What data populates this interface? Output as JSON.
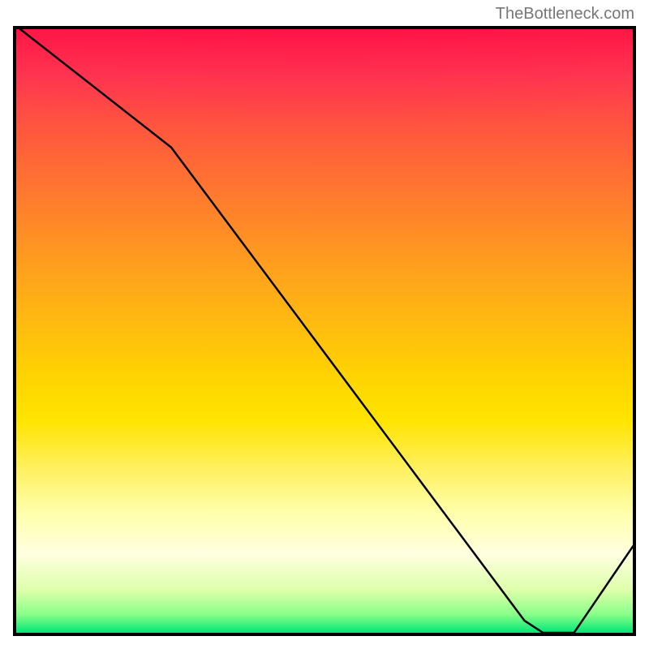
{
  "watermark": "TheBottleneck.com",
  "chart_data": {
    "type": "line",
    "title": "",
    "xlabel": "",
    "ylabel": "",
    "x": [
      0,
      25,
      82,
      85,
      90,
      100
    ],
    "values": [
      100,
      80,
      2,
      0,
      0,
      15
    ],
    "xlim": [
      0,
      100
    ],
    "ylim": [
      0,
      100
    ],
    "optimal_marker": {
      "label": "",
      "x": 87,
      "y": 0
    },
    "gradient": {
      "top": "#ff1744",
      "mid": "#ffd400",
      "bottom": "#00e676"
    }
  }
}
